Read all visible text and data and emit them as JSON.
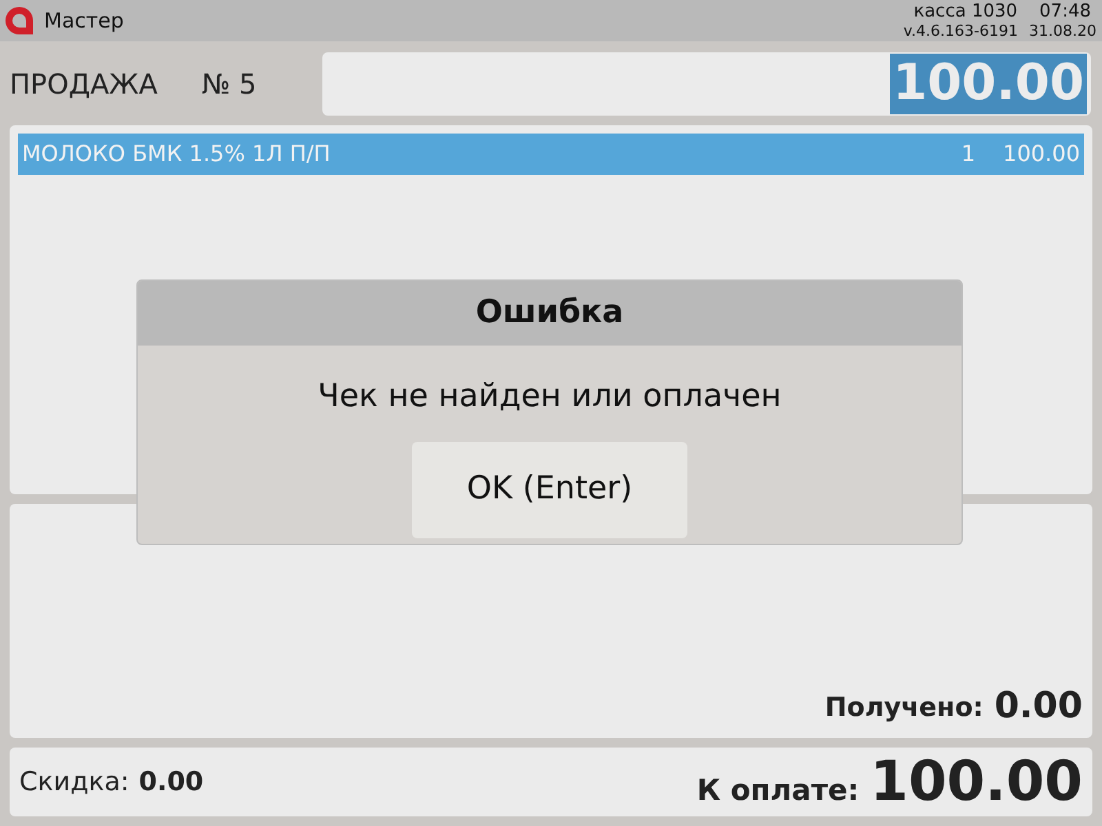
{
  "title_bar": {
    "app_name": "Мастер",
    "register": "касса 1030",
    "time": "07:48",
    "version": "v.4.6.163-6191",
    "date": "31.08.20"
  },
  "sale": {
    "title": "ПРОДАЖА",
    "number": "№ 5",
    "total": "100.00",
    "total_selected": true
  },
  "items": [
    {
      "name": "МОЛОКО БМК 1.5% 1Л П/П",
      "quantity": "1",
      "price": "100.00",
      "selected": true
    }
  ],
  "payment": {
    "received_label": "Получено:",
    "received": "0.00"
  },
  "footer": {
    "discount_label": "Скидка:",
    "discount": "0.00",
    "due_label": "К оплате:",
    "due": "100.00"
  },
  "dialog": {
    "title": "Ошибка",
    "message": "Чек не найден или оплачен",
    "button": "OK (Enter)"
  }
}
